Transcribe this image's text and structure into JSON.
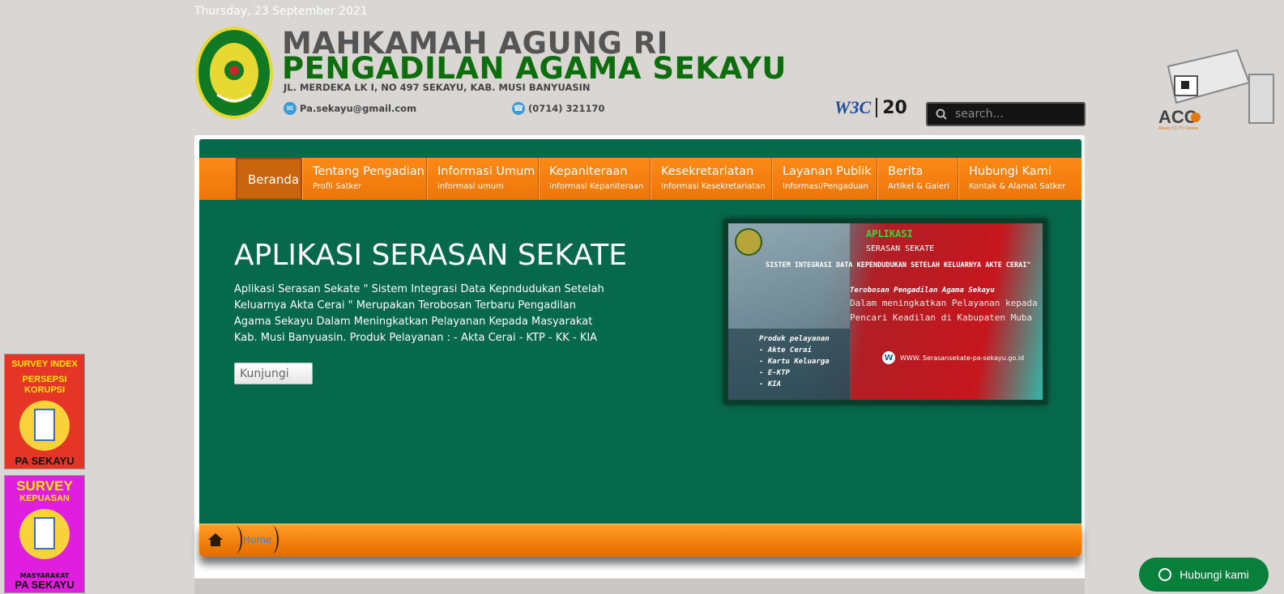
{
  "date": "Thursday, 23 September 2021",
  "header": {
    "title_line1": "MAHKAMAH AGUNG RI",
    "title_line2": "PENGADILAN AGAMA SEKAYU",
    "address": "JL. MERDEKA LK I, NO 497 SEKAYU, KAB. MUSI BANYUASIN",
    "email": "Pa.sekayu@gmail.com",
    "phone": "(0714) 321170",
    "logo_text": "PENGADILAN AGAMA SEKAYU",
    "w3c_text": "W3C",
    "w3c_anniv": "20"
  },
  "search": {
    "placeholder": "search..."
  },
  "cctv": {
    "label": "ACC",
    "sub": "Akses CCTV Online"
  },
  "nav": [
    {
      "label": "Beranda",
      "sub": ""
    },
    {
      "label": "Tentang Pengadian",
      "sub": "Profil Satker"
    },
    {
      "label": "Informasi Umum",
      "sub": "informasi umum"
    },
    {
      "label": "Kepaniteraan",
      "sub": "Informasi Kepaniteraan"
    },
    {
      "label": "Kesekretariatan",
      "sub": "Informasi Kesekretariatan"
    },
    {
      "label": "Layanan Publik",
      "sub": "Informasi/Pengaduan"
    },
    {
      "label": "Berita",
      "sub": "Artikel & Galeri"
    },
    {
      "label": "Hubungi Kami",
      "sub": "Kontak & Alamat Satker"
    }
  ],
  "slide": {
    "headline": "APLIKASI SERASAN SEKATE",
    "description": "Aplikasi Serasan Sekate \" Sistem Integrasi Data Kepndudukan Setelah Keluarnya Akta Cerai \" Merupakan Terobosan Terbaru Pengadilan Agama Sekayu Dalam Meningkatkan Pelayanan Kepada Masyarakat Kab. Musi Banyuasin. Produk Pelayanan : - Akta Cerai - KTP - KK - KIA",
    "button": "Kunjungi"
  },
  "banner": {
    "line1": "APLIKASI",
    "line2": "SERASAN SEKATE",
    "line3": "SISTEM INTEGRASI DATA KEPENDUDUKAN SETELAH KELUARNYA AKTE CERAI\"",
    "line4": "Terobosan Pengadilan Agama Sekayu",
    "line5": "Dalam meningkatkan Pelayanan kepada Masyarakat",
    "line6": "Pencari Keadilan di Kabupaten Muba",
    "products_title": "Produk pelayanan",
    "products": [
      "- Akte Cerai",
      "- Kartu Keluarga",
      "- E-KTP",
      "- KIA"
    ],
    "website": "WWW. Serasansekate-pa-sekayu.go.id",
    "w_icon": "W"
  },
  "breadcrumb": {
    "home_link": "Home"
  },
  "survey1": {
    "title_a": "SURVEY INDEX",
    "title_b": "PERSEPSI KORUPSI",
    "footer": "PA SEKAYU"
  },
  "survey2": {
    "title_a": "SURVEY",
    "title_b": "KEPUASAN",
    "sub": "MASYARAKAT",
    "footer": "PA SEKAYU"
  },
  "whatsapp": {
    "label": "Hubungi kami"
  }
}
